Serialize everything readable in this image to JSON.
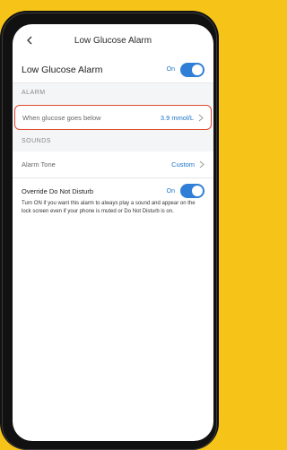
{
  "nav": {
    "title": "Low Glucose Alarm"
  },
  "main_toggle": {
    "label": "Low Glucose Alarm",
    "state_text": "On",
    "on": true
  },
  "sections": {
    "alarm": "ALARM",
    "sounds": "SOUNDS"
  },
  "glucose_threshold": {
    "label": "When glucose goes below",
    "value": "3.9 mmol/L"
  },
  "alarm_tone": {
    "label": "Alarm Tone",
    "value": "Custom"
  },
  "override_dnd": {
    "label": "Override Do Not Disturb",
    "state_text": "On",
    "on": true,
    "description": "Turn ON if you want this alarm to always play a sound and appear on the lock screen even if your phone is muted or Do Not Disturb is on."
  },
  "colors": {
    "background": "#f6c418",
    "accent": "#2f7fd6",
    "highlight": "#e0492b"
  }
}
